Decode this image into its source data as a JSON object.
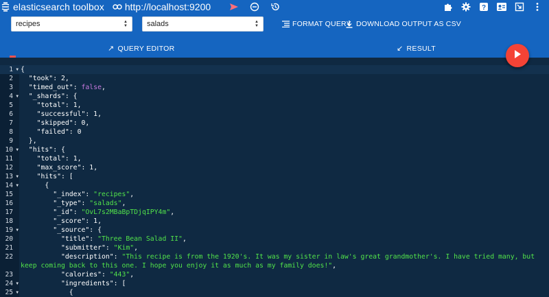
{
  "app": {
    "title": "elasticsearch toolbox",
    "url": "http://localhost:9200"
  },
  "icons": {
    "logo": "elastic-logo-icon",
    "link": "link-icon",
    "send": "send-icon",
    "clear": "minus-circle-icon",
    "history": "history-icon",
    "extensions": "puzzle-piece-icon",
    "settings": "gear-icon",
    "help": "help-icon",
    "account": "account-box-icon",
    "collapse": "window-collapse-icon",
    "menu": "more-vertical-icon",
    "format": "format-align-icon",
    "download": "download-icon",
    "play": "play-icon"
  },
  "toolbar": {
    "index_value": "recipes",
    "type_value": "salads",
    "format_label": "FORMAT QUERY",
    "download_label": "DOWNLOAD OUTPUT AS CSV"
  },
  "tabs": {
    "query_label": "QUERY EDITOR",
    "query_arrow": "↗",
    "result_label": "RESULT",
    "result_arrow": "↙"
  },
  "colors": {
    "header": "#1565c0",
    "editor_bg": "#0f2942",
    "string": "#52e34a",
    "boolean": "#c678dd",
    "fab": "#f44336"
  },
  "editor": {
    "lines": [
      {
        "num": "1",
        "fold": true,
        "text": "{"
      },
      {
        "num": "2",
        "fold": false,
        "text": "  \"took\": 2,"
      },
      {
        "num": "3",
        "fold": false,
        "text": "  \"timed_out\": false,"
      },
      {
        "num": "4",
        "fold": true,
        "text": "  \"_shards\": {"
      },
      {
        "num": "5",
        "fold": false,
        "text": "    \"total\": 1,"
      },
      {
        "num": "6",
        "fold": false,
        "text": "    \"successful\": 1,"
      },
      {
        "num": "7",
        "fold": false,
        "text": "    \"skipped\": 0,"
      },
      {
        "num": "8",
        "fold": false,
        "text": "    \"failed\": 0"
      },
      {
        "num": "9",
        "fold": false,
        "text": "  },"
      },
      {
        "num": "10",
        "fold": true,
        "text": "  \"hits\": {"
      },
      {
        "num": "11",
        "fold": false,
        "text": "    \"total\": 1,"
      },
      {
        "num": "12",
        "fold": false,
        "text": "    \"max_score\": 1,"
      },
      {
        "num": "13",
        "fold": true,
        "text": "    \"hits\": ["
      },
      {
        "num": "14",
        "fold": true,
        "text": "      {"
      },
      {
        "num": "15",
        "fold": false,
        "text": "        \"_index\": \"recipes\","
      },
      {
        "num": "16",
        "fold": false,
        "text": "        \"_type\": \"salads\","
      },
      {
        "num": "17",
        "fold": false,
        "text": "        \"_id\": \"OvL7s2MBaBpTDjqIPY4m\","
      },
      {
        "num": "18",
        "fold": false,
        "text": "        \"_score\": 1,"
      },
      {
        "num": "19",
        "fold": true,
        "text": "        \"_source\": {"
      },
      {
        "num": "20",
        "fold": false,
        "text": "          \"title\": \"Three Bean Salad II\","
      },
      {
        "num": "21",
        "fold": false,
        "text": "          \"submitter\": \"Kim\","
      },
      {
        "num": "22",
        "fold": false,
        "text": "          \"description\": \"This recipe is from the 1920's. It was my sister in law's great grandmother's. I have tried many, but keep coming back to this one. I hope you enjoy it as much as my family does!\","
      },
      {
        "num": "23",
        "fold": false,
        "text": "          \"calories\": \"443\","
      },
      {
        "num": "24",
        "fold": true,
        "text": "          \"ingredients\": ["
      },
      {
        "num": "25",
        "fold": true,
        "text": "            {"
      }
    ]
  }
}
